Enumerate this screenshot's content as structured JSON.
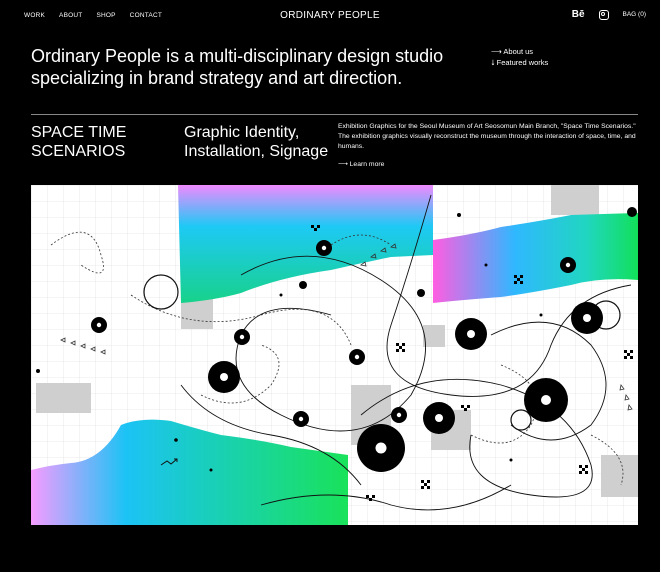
{
  "nav": {
    "items": [
      "WORK",
      "ABOUT",
      "SHOP",
      "CONTACT"
    ]
  },
  "brand": "ORDINARY PEOPLE",
  "header_right": {
    "behance": "Bē",
    "bag": "BAG (0)"
  },
  "intro": "Ordinary People is a multi-disciplinary design studio specializing in brand strategy and art direction.",
  "side_links": [
    "⟶ About us",
    "⭣ Featured works"
  ],
  "project": {
    "title": "SPACE TIME SCENARIOS",
    "category": "Graphic Identity, Installation, Signage",
    "description": "Exhibition Graphics for the Seoul Museum of Art Seosomun Main Branch, \"Space Time Scenarios.\" The exhibition graphics visually reconstruct the museum through the interaction of space, time, and humans.",
    "learn_more": "⟶ Learn more"
  },
  "icons": {
    "behance": "behance-icon",
    "instagram": "instagram-icon"
  }
}
